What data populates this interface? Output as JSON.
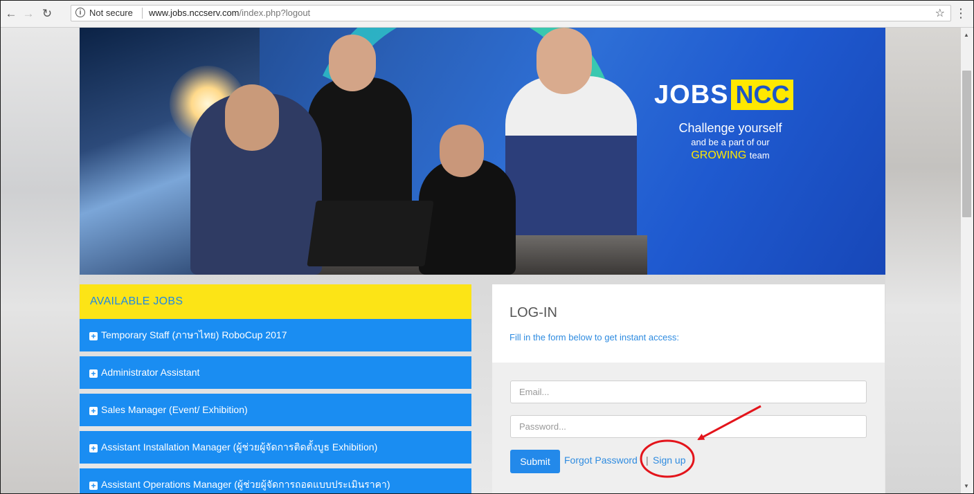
{
  "browser": {
    "back_icon": "arrow-left-icon",
    "forward_icon": "arrow-right-icon",
    "reload_icon": "reload-icon",
    "security_label": "Not secure",
    "url_host": "www.jobs.nccserv.com",
    "url_path": "/index.php?logout",
    "bookmark_icon": "star-icon",
    "menu_icon": "vertical-dots-icon"
  },
  "hero": {
    "logo_jobs": "JOBS",
    "logo_ncc": "NCC",
    "tagline_line1": "Challenge yourself",
    "tagline_line2": "and be a part of our",
    "tagline_highlight": "GROWING",
    "tagline_end": "team"
  },
  "jobs": {
    "header": "AVAILABLE JOBS",
    "items": [
      {
        "label": "Temporary Staff (ภาษาไทย) RoboCup 2017"
      },
      {
        "label": "Administrator Assistant"
      },
      {
        "label": "Sales Manager (Event/ Exhibition)"
      },
      {
        "label": "Assistant Installation Manager (ผู้ช่วยผู้จัดการติดตั้งบูธ Exhibition)"
      },
      {
        "label": "Assistant Operations Manager (ผู้ช่วยผู้จัดการถอดแบบประเมินราคา)"
      }
    ]
  },
  "login": {
    "title": "LOG-IN",
    "subtitle": "Fill in the form below to get instant access:",
    "email_placeholder": "Email...",
    "password_placeholder": "Password...",
    "submit_label": "Submit",
    "forgot_label": "Forgot Password",
    "separator": "|",
    "signup_label": "Sign up"
  },
  "colors": {
    "jobs_header_bg": "#fce416",
    "job_item_bg": "#1a8df2",
    "submit_bg": "#2389ea",
    "annotation": "#e3141b"
  }
}
